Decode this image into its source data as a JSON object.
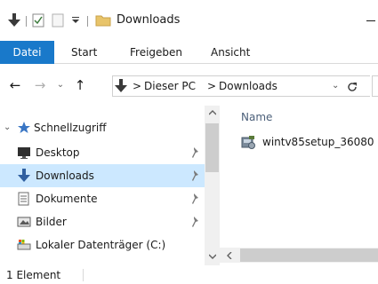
{
  "window": {
    "title": "Downloads"
  },
  "ribbon": {
    "tabs": [
      {
        "label": "Datei",
        "active": true
      },
      {
        "label": "Start"
      },
      {
        "label": "Freigeben"
      },
      {
        "label": "Ansicht"
      }
    ]
  },
  "address": {
    "path": [
      "Dieser PC",
      "Downloads"
    ],
    "separator": ">"
  },
  "navpane": {
    "items": [
      {
        "label": "Schnellzugriff",
        "icon": "star-icon"
      },
      {
        "label": "Desktop",
        "icon": "desktop-icon",
        "pinned": true
      },
      {
        "label": "Downloads",
        "icon": "download-arrow-icon",
        "pinned": true,
        "selected": true
      },
      {
        "label": "Dokumente",
        "icon": "document-icon",
        "pinned": true
      },
      {
        "label": "Bilder",
        "icon": "pictures-icon",
        "pinned": true
      },
      {
        "label": "Lokaler Datenträger (C:)",
        "icon": "drive-icon"
      }
    ]
  },
  "content": {
    "column_name": "Name",
    "files": [
      {
        "name": "wintv85setup_36080",
        "icon": "installer-icon"
      }
    ]
  },
  "status": {
    "count": "1 Element"
  },
  "colors": {
    "accent": "#1979ca",
    "selection": "#cce8ff"
  }
}
